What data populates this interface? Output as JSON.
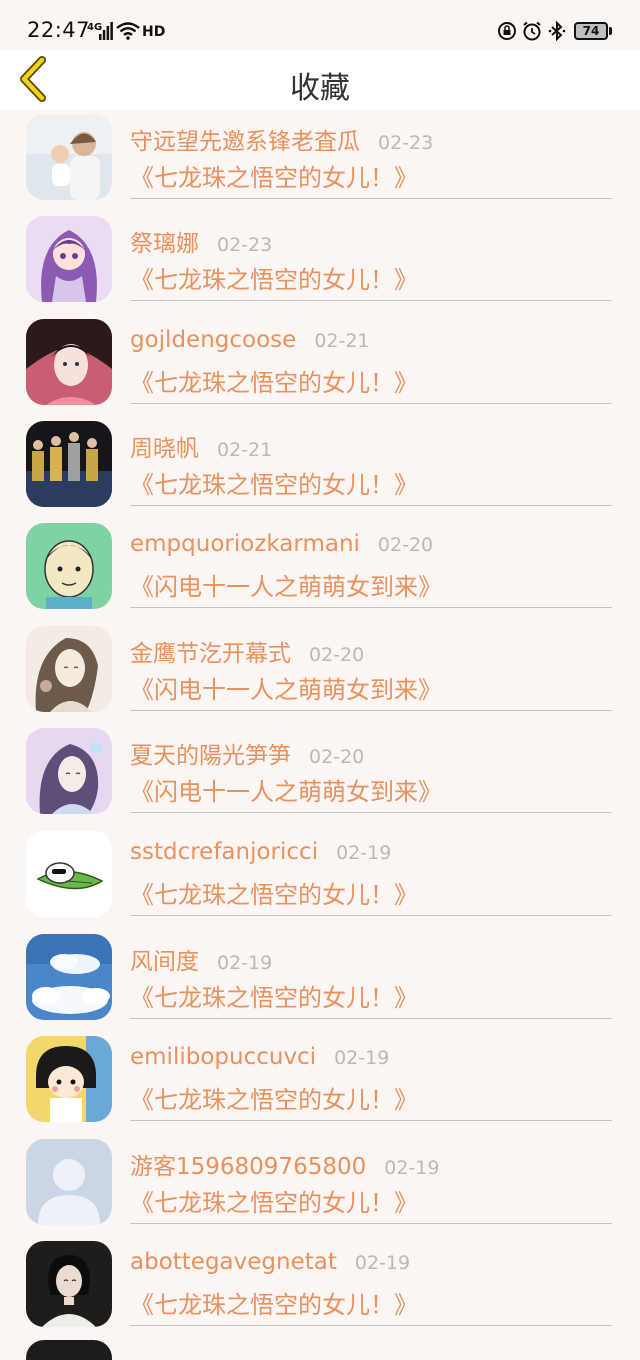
{
  "status": {
    "time": "22:47",
    "network": "4G",
    "hd": "HD",
    "battery": "74"
  },
  "header": {
    "title": "收藏",
    "back_icon": "chevron-left-icon"
  },
  "items": [
    {
      "name": "守远望先邀系锋老査瓜",
      "date": "02-23",
      "title": "《七龙珠之悟空的女儿！》",
      "avatar": "family-photo"
    },
    {
      "name": "祭璃娜",
      "date": "02-23",
      "title": "《七龙珠之悟空的女儿！》",
      "avatar": "anime-girl-purple"
    },
    {
      "name": "gojldengcoose",
      "date": "02-21",
      "title": "《七龙珠之悟空的女儿！》",
      "avatar": "girl-photo"
    },
    {
      "name": "周晓帆",
      "date": "02-21",
      "title": "《七龙珠之悟空的女儿！》",
      "avatar": "dance-group"
    },
    {
      "name": "empquoriozkarmani",
      "date": "02-20",
      "title": "《闪电十一人之萌萌女到来》",
      "avatar": "cartoon-man"
    },
    {
      "name": "金鹰节汔开幕式",
      "date": "02-20",
      "title": "《闪电十一人之萌萌女到来》",
      "avatar": "sketch-girl"
    },
    {
      "name": "夏天的陽光笋笋",
      "date": "02-20",
      "title": "《闪电十一人之萌萌女到来》",
      "avatar": "sketch-girl-purple"
    },
    {
      "name": "sstdcrefanjoricci",
      "date": "02-19",
      "title": "《七龙珠之悟空的女儿！》",
      "avatar": "cartoon-leaf"
    },
    {
      "name": "风间度",
      "date": "02-19",
      "title": "《七龙珠之悟空的女儿！》",
      "avatar": "sky-clouds"
    },
    {
      "name": "emilibopuccuvci",
      "date": "02-19",
      "title": "《七龙珠之悟空的女儿！》",
      "avatar": "chibi-maruko"
    },
    {
      "name": "游客1596809765800",
      "date": "02-19",
      "title": "《七龙珠之悟空的女儿！》",
      "avatar": "default-avatar"
    },
    {
      "name": "abottegavegnetat",
      "date": "02-19",
      "title": "《七龙珠之悟空的女儿！》",
      "avatar": "woman-portrait"
    }
  ]
}
